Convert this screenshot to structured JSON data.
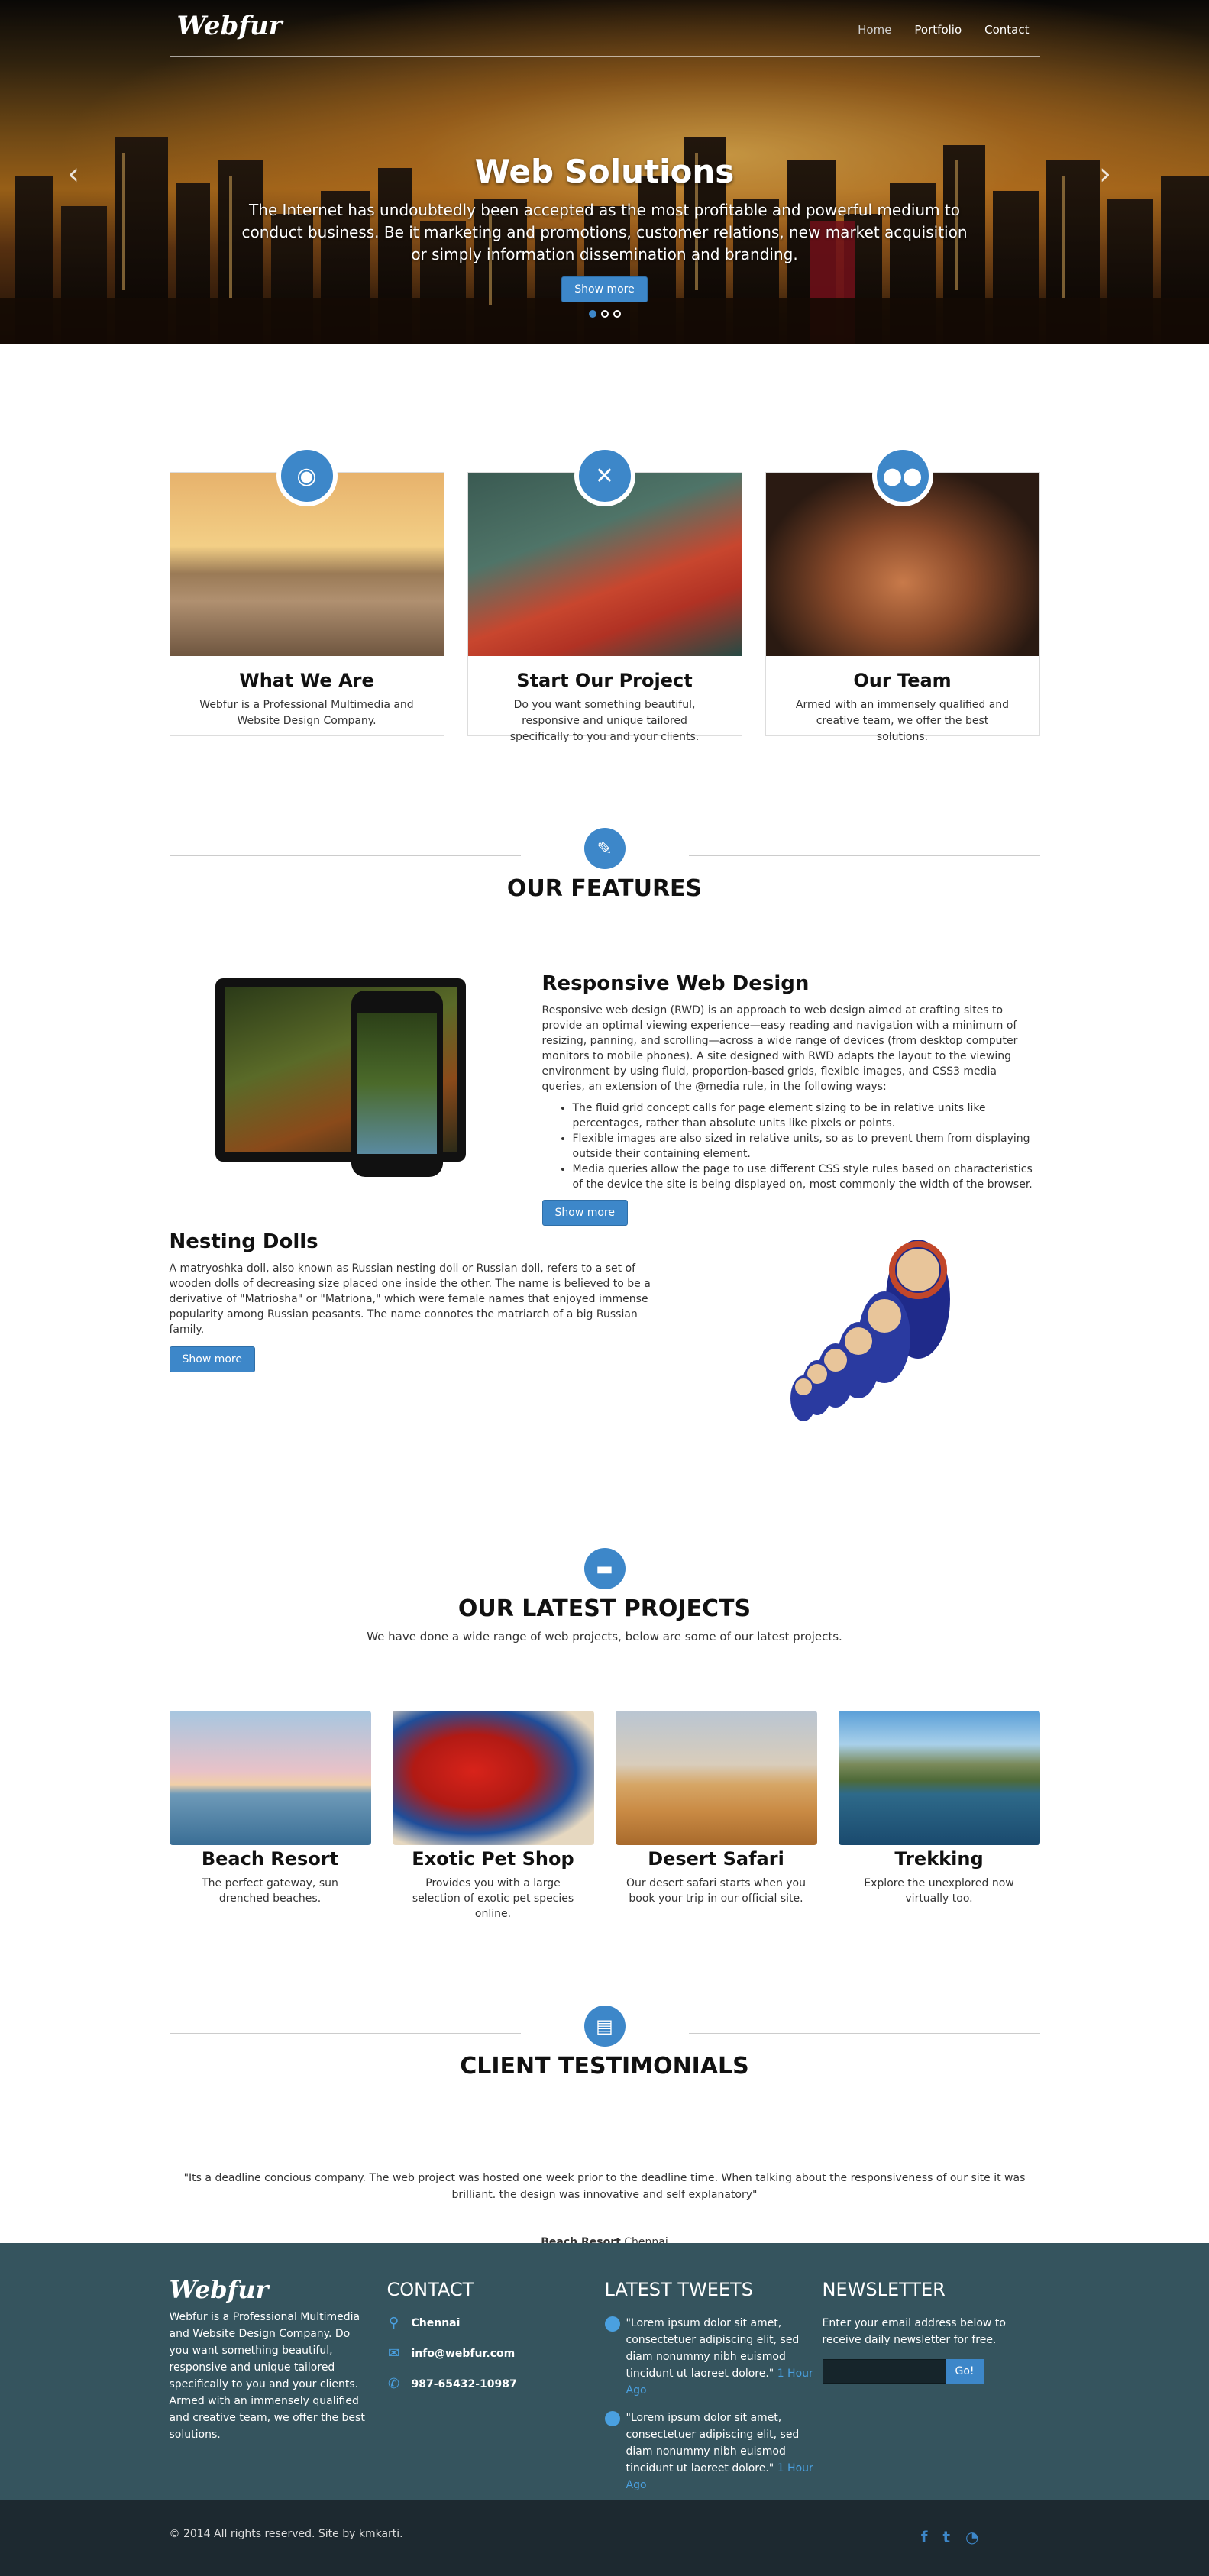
{
  "brand": {
    "logo": "Webfur"
  },
  "nav": [
    {
      "label": "Home"
    },
    {
      "label": "Portfolio"
    },
    {
      "label": "Contact"
    }
  ],
  "hero": {
    "title": "Web Solutions",
    "text": "The Internet has undoubtedly been accepted as the most profitable and powerful medium to conduct business. Be it marketing and promotions, customer relations, new market acquisition or simply information dissemination and branding.",
    "button": "Show more",
    "slides": 3,
    "active_slide": 1
  },
  "cards": [
    {
      "icon": "camera-icon",
      "title": "What We Are",
      "text": "Webfur is a Professional Multimedia and Website Design Company."
    },
    {
      "icon": "tools-icon",
      "title": "Start Our Project",
      "text": "Do you want something beautiful, responsive and unique tailored specifically to you and your clients."
    },
    {
      "icon": "users-icon",
      "title": "Our Team",
      "text": "Armed with an immensely qualified and creative team, we offer the best solutions."
    }
  ],
  "features": {
    "heading": "OUR FEATURES",
    "items": [
      {
        "title": "Responsive Web Design",
        "text": "Responsive web design (RWD) is an approach to web design aimed at crafting sites to provide an optimal viewing experience—easy reading and navigation with a minimum of resizing, panning, and scrolling—across a wide range of devices (from desktop computer monitors to mobile phones). A site designed with RWD adapts the layout to the viewing environment by using fluid, proportion-based grids, flexible images, and CSS3 media queries, an extension of the @media rule, in the following ways:",
        "bullets": [
          "The fluid grid concept calls for page element sizing to be in relative units like percentages, rather than absolute units like pixels or points.",
          "Flexible images are also sized in relative units, so as to prevent them from displaying outside their containing element.",
          "Media queries allow the page to use different CSS style rules based on characteristics of the device the site is being displayed on, most commonly the width of the browser."
        ],
        "button": "Show more"
      },
      {
        "title": "Nesting Dolls",
        "text": "A matryoshka doll, also known as Russian nesting doll or Russian doll, refers to a set of wooden dolls of decreasing size placed one inside the other. The name is believed to be a derivative of \"Matriosha\" or \"Matriona,\" which were female names that enjoyed immense popularity among Russian peasants. The name connotes the matriarch of a big Russian family.",
        "button": "Show more"
      }
    ]
  },
  "projects": {
    "heading": "OUR LATEST PROJECTS",
    "subheading": "We have done a wide range of web projects, below are some of our latest projects.",
    "items": [
      {
        "title": "Beach Resort",
        "text": "The perfect gateway, sun drenched beaches."
      },
      {
        "title": "Exotic Pet Shop",
        "text": "Provides you with a large selection of exotic pet species online."
      },
      {
        "title": "Desert Safari",
        "text": "Our desert safari starts when you book your trip in our official site."
      },
      {
        "title": "Trekking",
        "text": "Explore the unexplored now virtually too."
      }
    ]
  },
  "testimonials": {
    "heading": "CLIENT TESTIMONIALS",
    "quote": "\"Its a deadline concious company. The web project was hosted one week prior to the deadline time. When talking about the responsiveness of our site it was brilliant. the design was innovative and self explanatory\"",
    "client": "Beach Resort",
    "location": ",Chennai",
    "slides": 5,
    "active_slide": 1
  },
  "footer": {
    "logo": "Webfur",
    "about": "Webfur is a Professional Multimedia and Website Design Company. Do you want something beautiful, responsive and unique tailored specifically to you and your clients. Armed with an immensely qualified and creative team, we offer the best solutions.",
    "contact_heading": "CONTACT",
    "contact": [
      {
        "icon": "map-pin-icon",
        "text": "Chennai"
      },
      {
        "icon": "mail-icon",
        "text": "info@webfur.com"
      },
      {
        "icon": "phone-icon",
        "text": "987-65432-10987"
      }
    ],
    "tweets_heading": "LATEST TWEETS",
    "tweets": [
      {
        "text": "\"Lorem ipsum dolor sit amet, consectetuer adipiscing elit, sed diam nonummy nibh euismod tincidunt ut laoreet dolore.\"",
        "ago": "1 Hour Ago"
      },
      {
        "text": "\"Lorem ipsum dolor sit amet, consectetuer adipiscing elit, sed diam nonummy nibh euismod tincidunt ut laoreet dolore.\"",
        "ago": "1 Hour Ago"
      }
    ],
    "newsletter_heading": "NEWSLETTER",
    "newsletter_text": "Enter your email address below to receive daily newsletter for free.",
    "newsletter_button": "Go!",
    "copyright": "© 2014 All rights reserved. Site by kmkarti.",
    "social": [
      "facebook-icon",
      "twitter-icon",
      "rss-icon"
    ]
  },
  "colors": {
    "accent": "#3d87c9",
    "footer_bg": "#35545e",
    "bottom_bg": "#1d2930"
  }
}
